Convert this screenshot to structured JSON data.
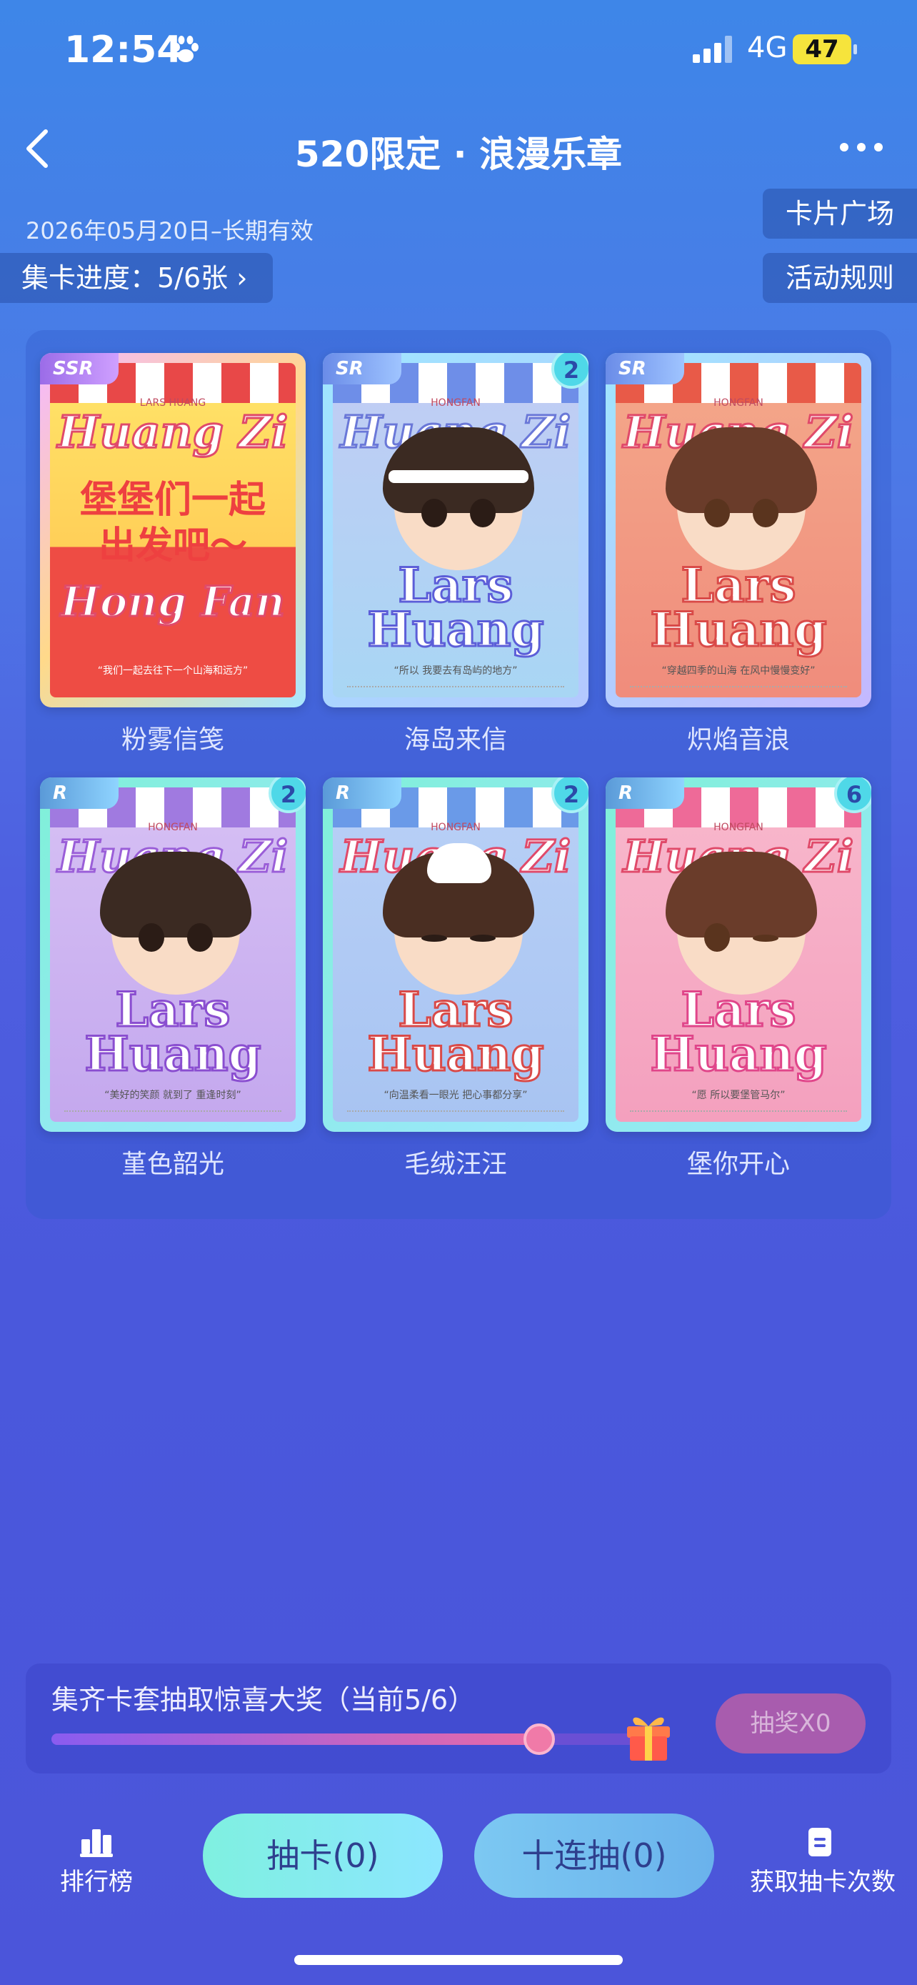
{
  "status_bar": {
    "time": "12:54",
    "network": "4G",
    "battery": "47"
  },
  "nav": {
    "title": "520限定 · 浪漫乐章"
  },
  "event": {
    "date_range": "2026年05月20日–长期有效",
    "progress_label": "集卡进度：5/6张 ›"
  },
  "side_buttons": {
    "card_plaza": "卡片广场",
    "rules": "活动规则"
  },
  "cards": [
    {
      "name": "粉雾信笺",
      "rarity": "SSR",
      "count": null,
      "brand": "Huang Zi",
      "lead": "堡堡们一起出发吧～",
      "label": "Hong Fan",
      "tag": "LARS HUANG",
      "quote": "“我们一起去往下一个山海和远方”"
    },
    {
      "name": "海岛来信",
      "rarity": "SR",
      "count": "2",
      "brand": "Huang Zi",
      "lead": "Lars Huang",
      "tag": "HONGFAN",
      "quote": "“所以 我要去有岛屿的地方”"
    },
    {
      "name": "炽焰音浪",
      "rarity": "SR",
      "count": null,
      "brand": "Huang Zi",
      "lead": "Lars Huang",
      "tag": "HONGFAN",
      "quote": "“穿越四季的山海 在风中慢慢变好”"
    },
    {
      "name": "堇色韶光",
      "rarity": "R",
      "count": "2",
      "brand": "Huang Zi",
      "lead": "Lars Huang",
      "tag": "HONGFAN",
      "quote": "“美好的笑颜 就到了 重逢时刻”"
    },
    {
      "name": "毛绒汪汪",
      "rarity": "R",
      "count": "2",
      "brand": "Huang Zi",
      "lead": "Lars Huang",
      "tag": "HONGFAN",
      "quote": "“向温柔看一眼光 把心事都分享”"
    },
    {
      "name": "堡你开心",
      "rarity": "R",
      "count": "6",
      "brand": "Huang Zi",
      "lead": "Lars Huang",
      "tag": "HONGFAN",
      "quote": "“愿 所以要堡管马尔”"
    }
  ],
  "prize": {
    "text": "集齐卡套抽取惊喜大奖（当前5/6）",
    "progress": 0.833,
    "button": "抽奖X0"
  },
  "bottom_nav": {
    "rank": "排行榜",
    "draw_one": "抽卡(0)",
    "draw_ten": "十连抽(0)",
    "get_chances": "获取抽卡次数"
  },
  "colors": {
    "ssr": "#9b6ce8",
    "sr": "#6a8ce8",
    "r": "#5a9ad8",
    "count_badge": "#4fd8e8"
  }
}
